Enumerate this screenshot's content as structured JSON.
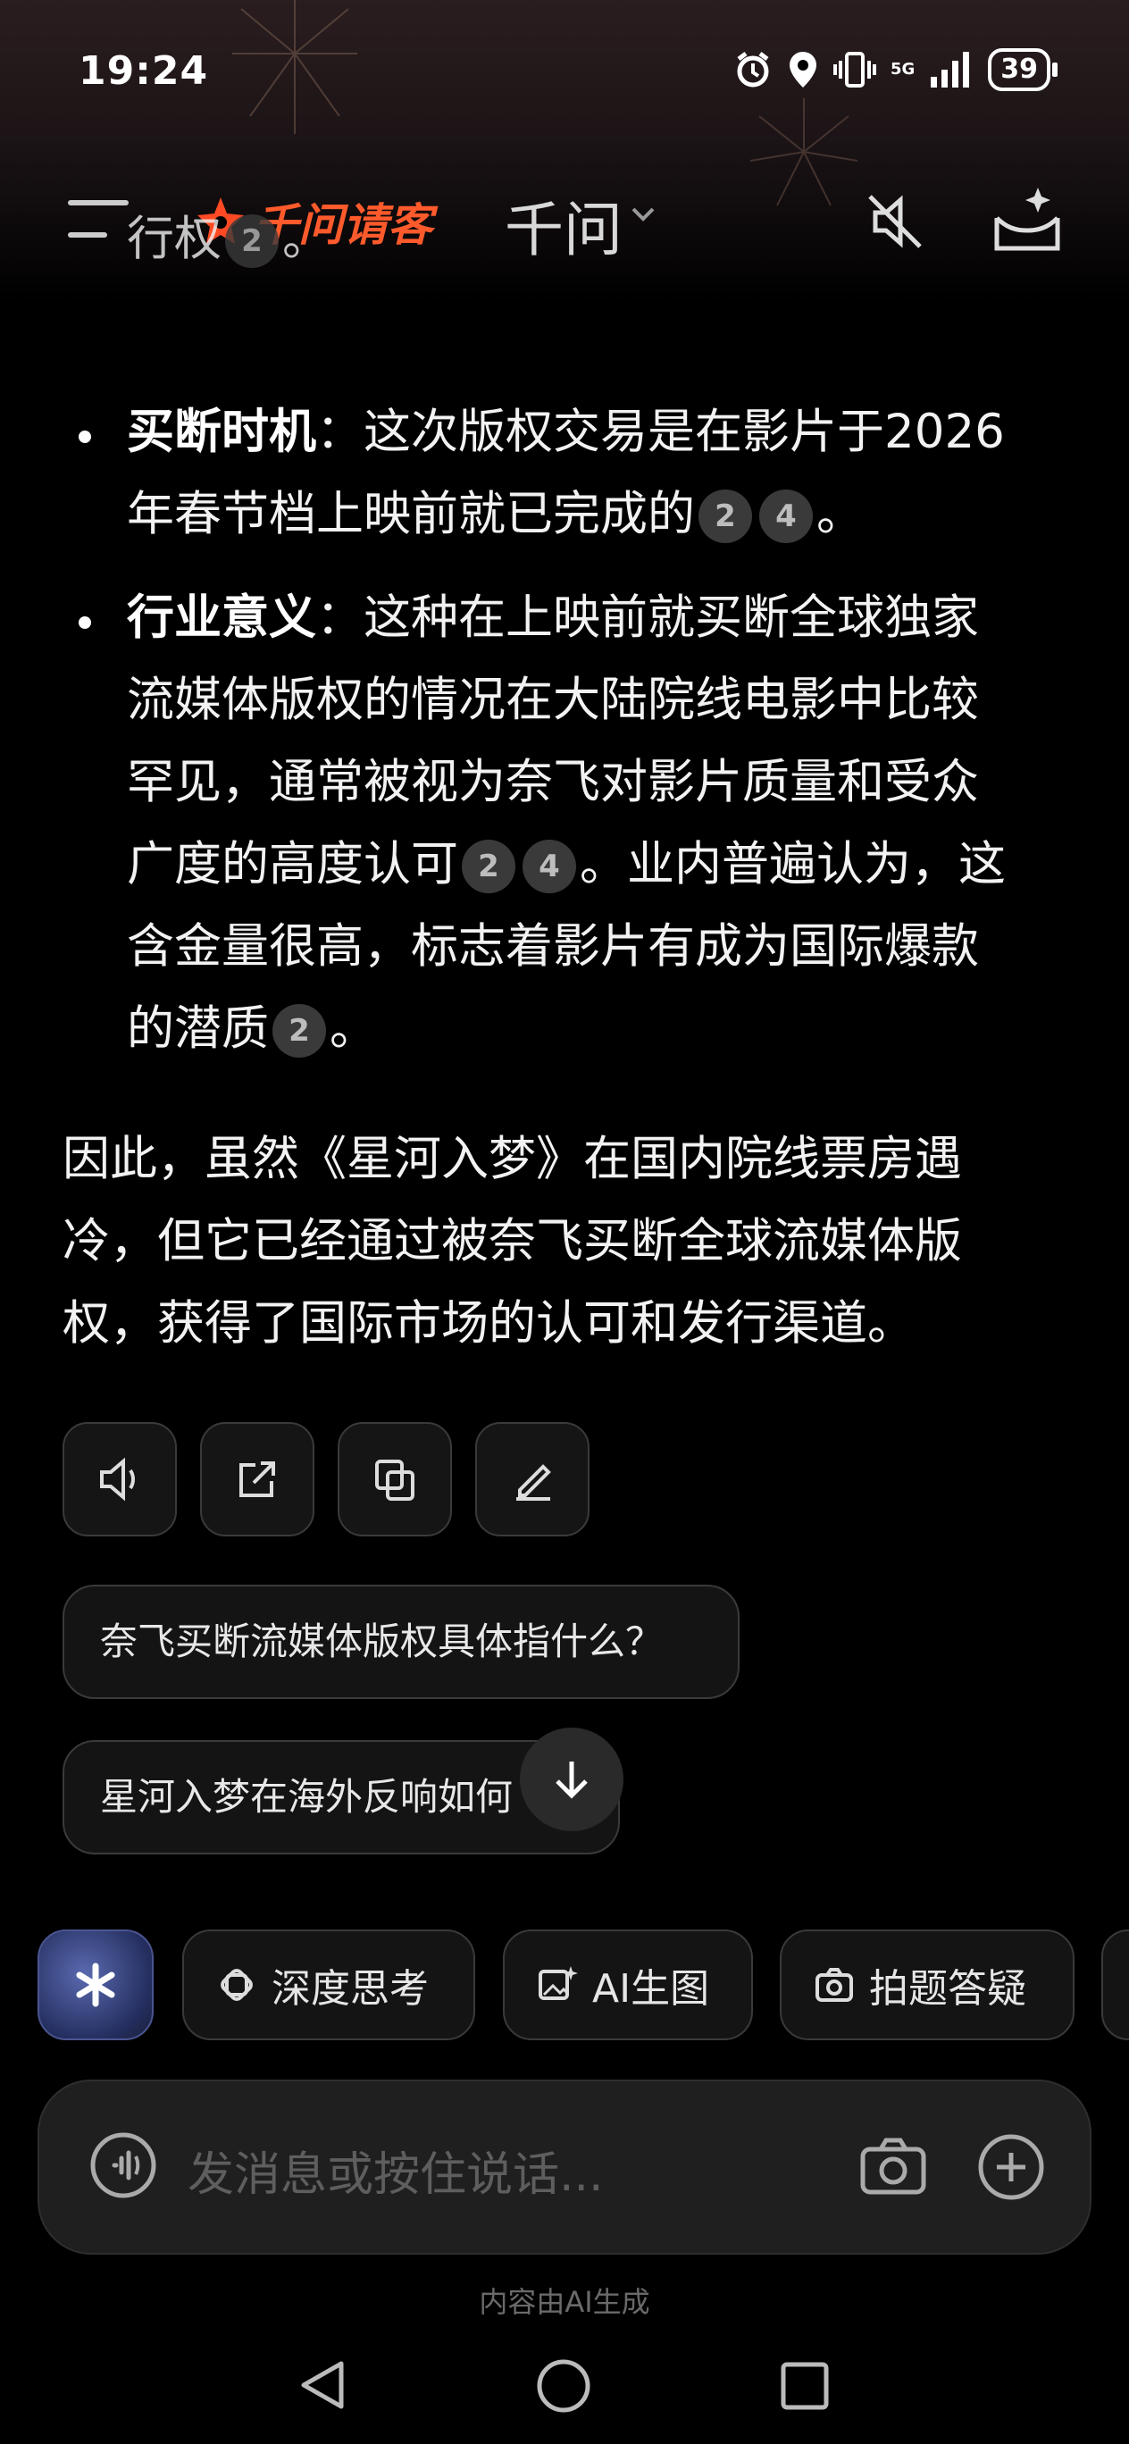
{
  "status_bar": {
    "time": "19:24",
    "network": "5G",
    "battery": "39"
  },
  "header": {
    "brand": "千问请客",
    "model": "千问"
  },
  "content": {
    "partial_line": "行权",
    "partial_cite": "2",
    "partial_end": "。",
    "bullets": [
      {
        "title": "买断时机",
        "line1": "：这次版权交易是在影片于2026",
        "line2": "年春节档上映前就已完成的",
        "cites": [
          "2",
          "4"
        ],
        "end": "。"
      },
      {
        "title": "行业意义",
        "line1": "：这种在上映前就买断全球独家",
        "line2": "流媒体版权的情况在大陆院线电影中比较",
        "line3": "罕见，通常被视为奈飞对影片质量和受众",
        "line4a": "广度的高度认可",
        "line4_cites": [
          "2",
          "4"
        ],
        "line4b": "。业内普遍认为，这",
        "line5": "含金量很高，标志着影片有成为国际爆款",
        "line6": "的潜质",
        "line6_cite": "2",
        "end": "。"
      }
    ],
    "conclusion": [
      "因此，虽然《星河入梦》在国内院线票房遇",
      "冷，但它已经通过被奈飞买断全球流媒体版",
      "权，获得了国际市场的认可和发行渠道。"
    ]
  },
  "suggestions": [
    "奈飞买断流媒体版权具体指什么？",
    "星河入梦在海外反响如何"
  ],
  "tools": {
    "deep_think": "深度思考",
    "ai_image": "AI生图",
    "photo_qa": "拍题答疑"
  },
  "input": {
    "placeholder": "发消息或按住说话..."
  },
  "footer_note": "内容由AI生成"
}
